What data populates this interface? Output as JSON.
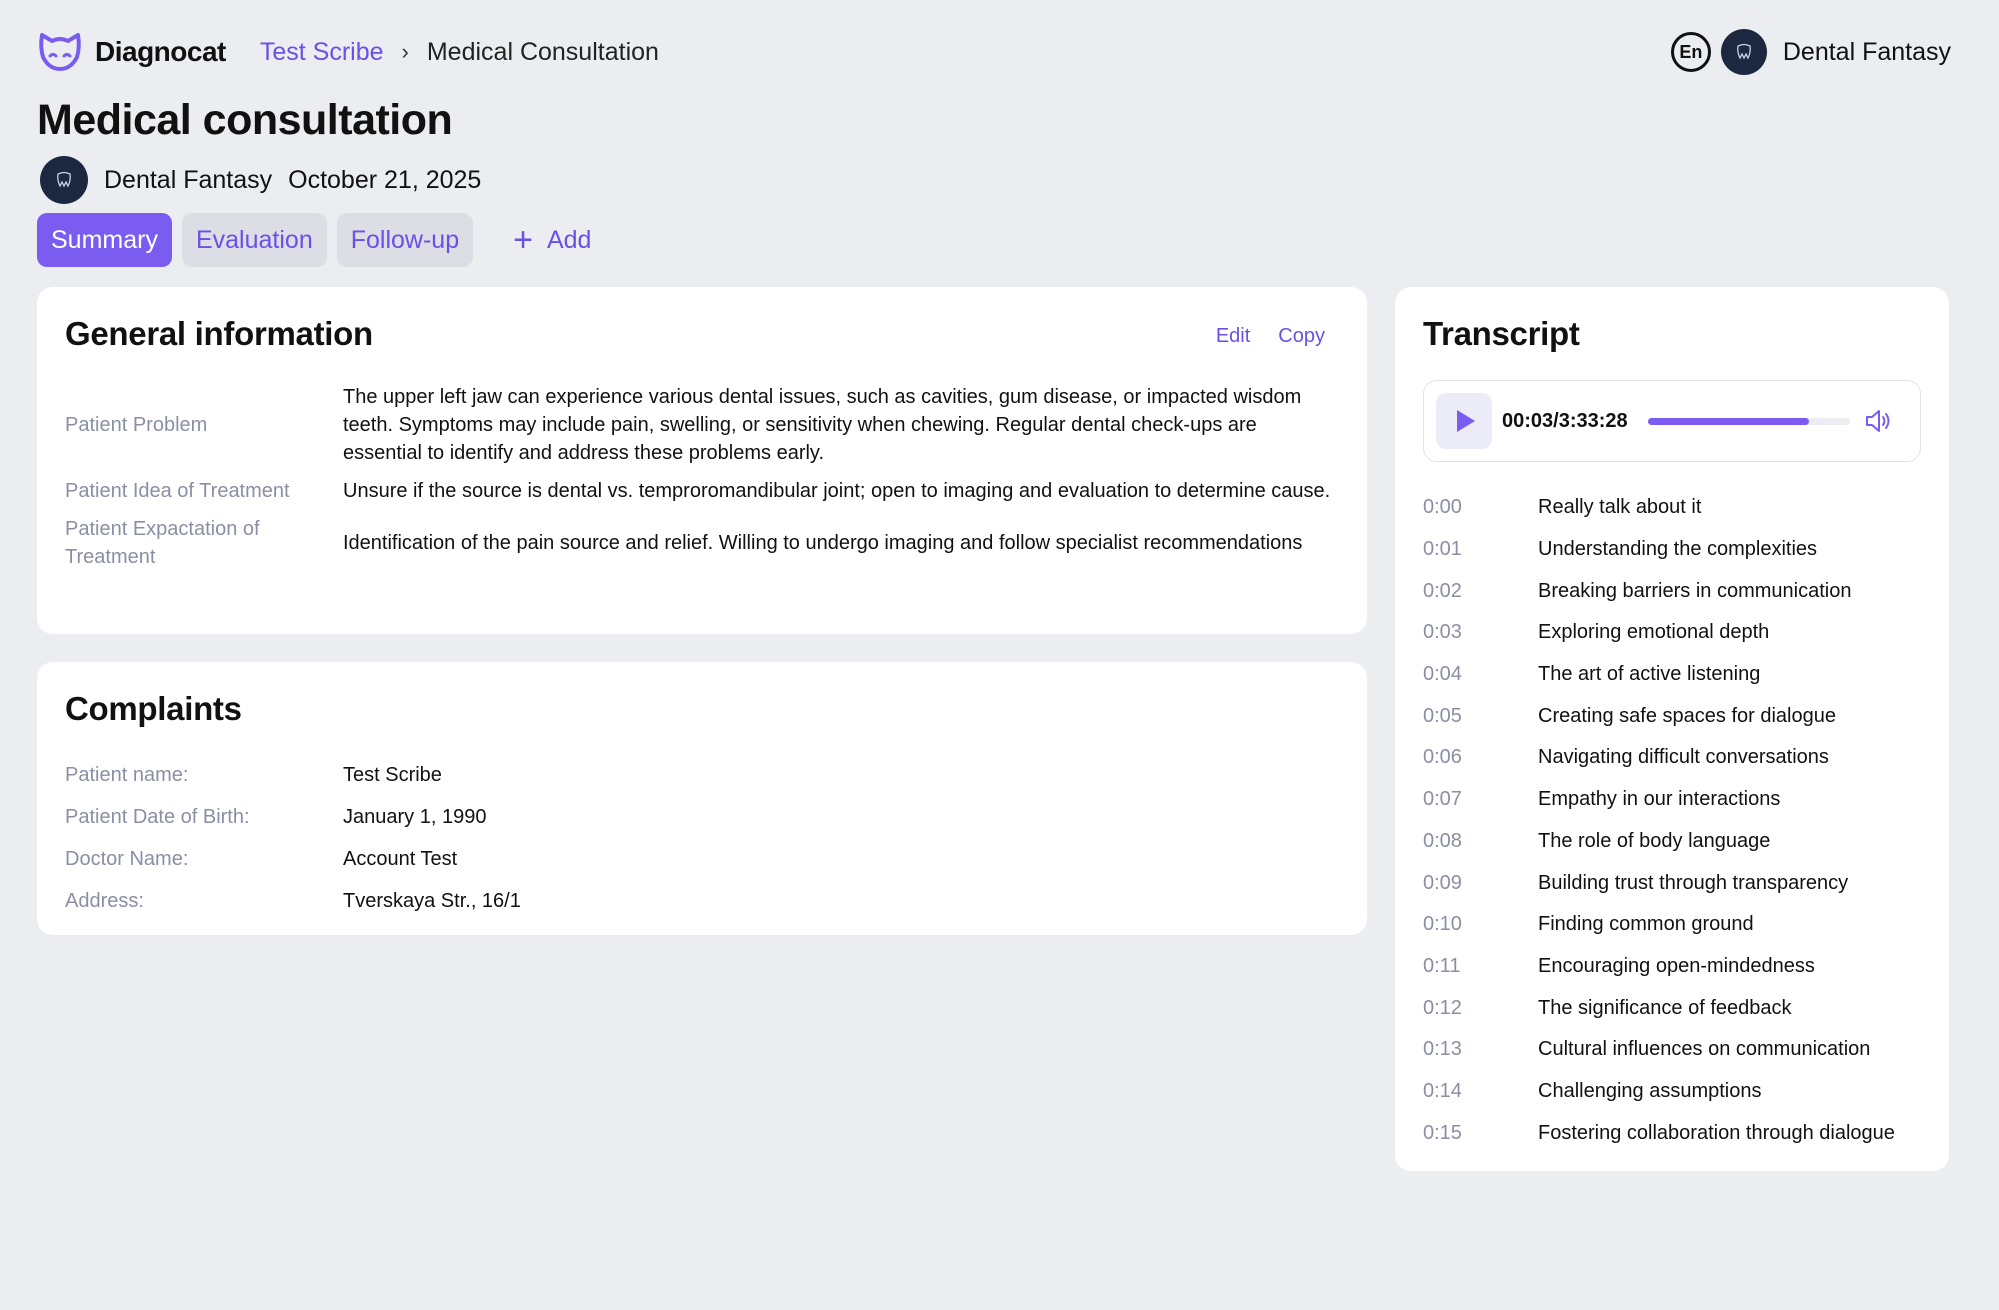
{
  "header": {
    "logo_text": "Diagnocat",
    "breadcrumb": {
      "link": "Test Scribe",
      "current": "Medical Consultation"
    },
    "language": "En",
    "org_name": "Dental Fantasy"
  },
  "page": {
    "title": "Medical consultation",
    "org": "Dental Fantasy",
    "date": "October 21, 2025"
  },
  "tabs": [
    {
      "label": "Summary",
      "active": true
    },
    {
      "label": "Evaluation",
      "active": false
    },
    {
      "label": "Follow-up",
      "active": false
    }
  ],
  "add_label": "Add",
  "general": {
    "title": "General information",
    "edit_label": "Edit",
    "copy_label": "Copy",
    "rows": [
      {
        "label": "Patient Problem",
        "value": "The upper left jaw can experience various dental issues, such as cavities, gum disease, or impacted wisdom teeth. Symptoms may include pain, swelling, or sensitivity when chewing. Regular dental check-ups are essential to identify and address these problems early."
      },
      {
        "label": "Patient Idea of Treatment",
        "value": "Unsure if the source is dental vs. temproromandibular joint; open to imaging and evaluation to determine cause."
      },
      {
        "label": "Patient Expactation of Treatment",
        "value": "Identification of the pain source and relief. Willing to undergo imaging and follow specialist recommendations"
      }
    ]
  },
  "complaints": {
    "title": "Complaints",
    "rows": [
      {
        "label": "Patient name:",
        "value": "Test Scribe"
      },
      {
        "label": "Patient Date of Birth:",
        "value": "January 1, 1990"
      },
      {
        "label": "Doctor Name:",
        "value": "Account Test"
      },
      {
        "label": "Address:",
        "value": "Tverskaya Str., 16/1"
      }
    ]
  },
  "transcript": {
    "title": "Transcript",
    "player": {
      "time": "00:03/3:33:28",
      "progress": 0.8
    },
    "lines": [
      {
        "time": "0:00",
        "text": "Really talk about it"
      },
      {
        "time": "0:01",
        "text": "Understanding the complexities"
      },
      {
        "time": "0:02",
        "text": "Breaking barriers in communication"
      },
      {
        "time": "0:03",
        "text": "Exploring emotional depth"
      },
      {
        "time": "0:04",
        "text": "The art of active listening"
      },
      {
        "time": "0:05",
        "text": "Creating safe spaces for dialogue"
      },
      {
        "time": "0:06",
        "text": "Navigating difficult conversations"
      },
      {
        "time": "0:07",
        "text": "Empathy in our interactions"
      },
      {
        "time": "0:08",
        "text": "The role of body language"
      },
      {
        "time": "0:09",
        "text": "Building trust through transparency"
      },
      {
        "time": "0:10",
        "text": "Finding common ground"
      },
      {
        "time": "0:11",
        "text": "Encouraging open-mindedness"
      },
      {
        "time": "0:12",
        "text": "The significance of feedback"
      },
      {
        "time": "0:13",
        "text": "Cultural influences on communication"
      },
      {
        "time": "0:14",
        "text": "Challenging assumptions"
      },
      {
        "time": "0:15",
        "text": "Fostering collaboration through dialogue"
      }
    ]
  },
  "colors": {
    "accent": "#7b5cf0",
    "link": "#6a50e6",
    "muted": "#8a8fa3",
    "background": "#ecedf1"
  },
  "icons": {
    "logo": "cat-logo-icon",
    "avatar": "dental-clinic-logo",
    "play": "play-icon",
    "volume": "volume-icon",
    "add": "plus-icon",
    "chevron": "chevron-right-icon"
  }
}
